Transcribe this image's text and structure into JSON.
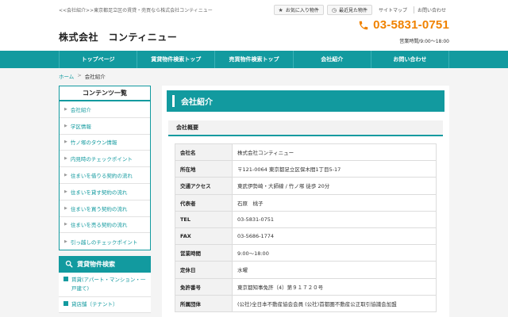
{
  "header": {
    "tagline": "<<会社紹介>>東京都足立区の賃貸・売買なら株式会社コンティニュー",
    "favorites_label": "お気に入り物件",
    "recent_label": "最近見た物件",
    "sitemap_label": "サイトマップ",
    "contact_label": "お問い合わせ",
    "company_name": "株式会社　コンティニュー",
    "phone": "03-5831-0751",
    "hours": "営業時間/9:00～18:00"
  },
  "nav": {
    "items": [
      "トップページ",
      "賃貸物件検索トップ",
      "売買物件検索トップ",
      "会社紹介",
      "お問い合わせ"
    ]
  },
  "breadcrumb": {
    "home": "ホーム",
    "sep": ">",
    "current": "会社紹介"
  },
  "sidebar": {
    "contents_title": "コンテンツ一覧",
    "items": [
      "会社紹介",
      "学区情報",
      "竹ノ塚のタウン情報",
      "内見時のチェックポイント",
      "住まいを借りる契約の流れ",
      "住まいを貸す契約の流れ",
      "住まいを買う契約の流れ",
      "住まいを売る契約の流れ",
      "引っ越しのチェックポイント"
    ],
    "search_title": "賃貸物件検索",
    "search_items": [
      "賃貸(アパート・マンション・一戸建て)",
      "貸店舗（テナント）"
    ]
  },
  "main": {
    "title": "会社紹介",
    "section_title": "会社概要",
    "rows": [
      {
        "key": "会社名",
        "value": "株式会社コンティニュー"
      },
      {
        "key": "所在地",
        "value": "〒121-0064 東京都足立区保木間1丁目5-17"
      },
      {
        "key": "交通アクセス",
        "value": "東武伊勢崎・大師線 / 竹ノ塚 徒歩 20分"
      },
      {
        "key": "代表者",
        "value": "石原　桃子"
      },
      {
        "key": "TEL",
        "value": "03-5831-0751"
      },
      {
        "key": "FAX",
        "value": "03-5686-1774"
      },
      {
        "key": "営業時間",
        "value": "9:00～18:00"
      },
      {
        "key": "定休日",
        "value": "水曜"
      },
      {
        "key": "免許番号",
        "value": "東京都知事免許（4）第９１７２０号"
      },
      {
        "key": "所属団体",
        "value": "(公社)全日本不動産協会会員 (公社)首都圏不動産公正取引協議会加盟"
      }
    ]
  },
  "colors": {
    "accent": "#129a9f",
    "phone": "#f08200"
  }
}
